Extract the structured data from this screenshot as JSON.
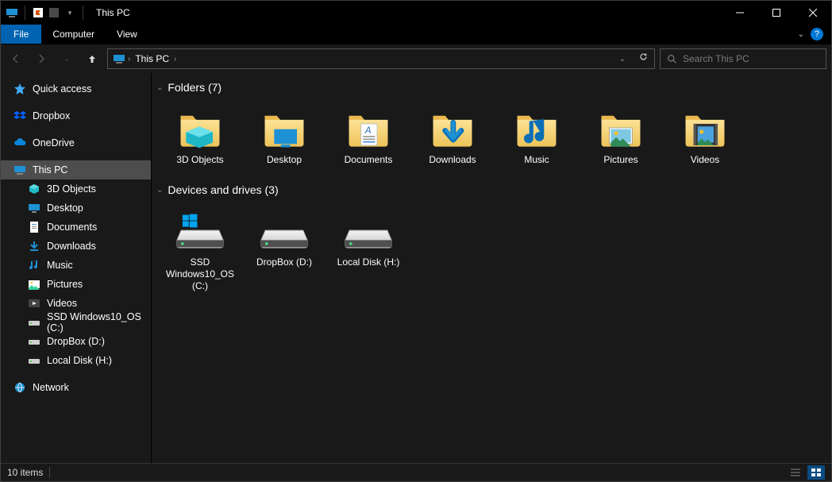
{
  "window": {
    "title": "This PC"
  },
  "ribbon": {
    "file": "File",
    "tabs": [
      "Computer",
      "View"
    ]
  },
  "nav": {
    "breadcrumb": "This PC",
    "search_placeholder": "Search This PC"
  },
  "sidebar": {
    "top": [
      {
        "label": "Quick access",
        "icon": "star"
      },
      {
        "label": "Dropbox",
        "icon": "dropbox"
      },
      {
        "label": "OneDrive",
        "icon": "onedrive"
      }
    ],
    "thispc_label": "This PC",
    "thispc_children": [
      {
        "label": "3D Objects",
        "icon": "3d"
      },
      {
        "label": "Desktop",
        "icon": "desktop"
      },
      {
        "label": "Documents",
        "icon": "documents"
      },
      {
        "label": "Downloads",
        "icon": "downloads"
      },
      {
        "label": "Music",
        "icon": "music"
      },
      {
        "label": "Pictures",
        "icon": "pictures"
      },
      {
        "label": "Videos",
        "icon": "videos"
      },
      {
        "label": "SSD Windows10_OS (C:)",
        "icon": "drive"
      },
      {
        "label": "DropBox (D:)",
        "icon": "drive"
      },
      {
        "label": "Local Disk (H:)",
        "icon": "drive"
      }
    ],
    "network_label": "Network"
  },
  "content": {
    "folders_header": "Folders (7)",
    "folders": [
      {
        "label": "3D Objects",
        "overlay": "3d"
      },
      {
        "label": "Desktop",
        "overlay": "desktop"
      },
      {
        "label": "Documents",
        "overlay": "documents"
      },
      {
        "label": "Downloads",
        "overlay": "downloads"
      },
      {
        "label": "Music",
        "overlay": "music"
      },
      {
        "label": "Pictures",
        "overlay": "pictures"
      },
      {
        "label": "Videos",
        "overlay": "videos"
      }
    ],
    "drives_header": "Devices and drives (3)",
    "drives": [
      {
        "label": "SSD Windows10_OS (C:)",
        "os": true
      },
      {
        "label": "DropBox (D:)",
        "os": false
      },
      {
        "label": "Local Disk (H:)",
        "os": false
      }
    ]
  },
  "status": {
    "item_count": "10 items"
  }
}
